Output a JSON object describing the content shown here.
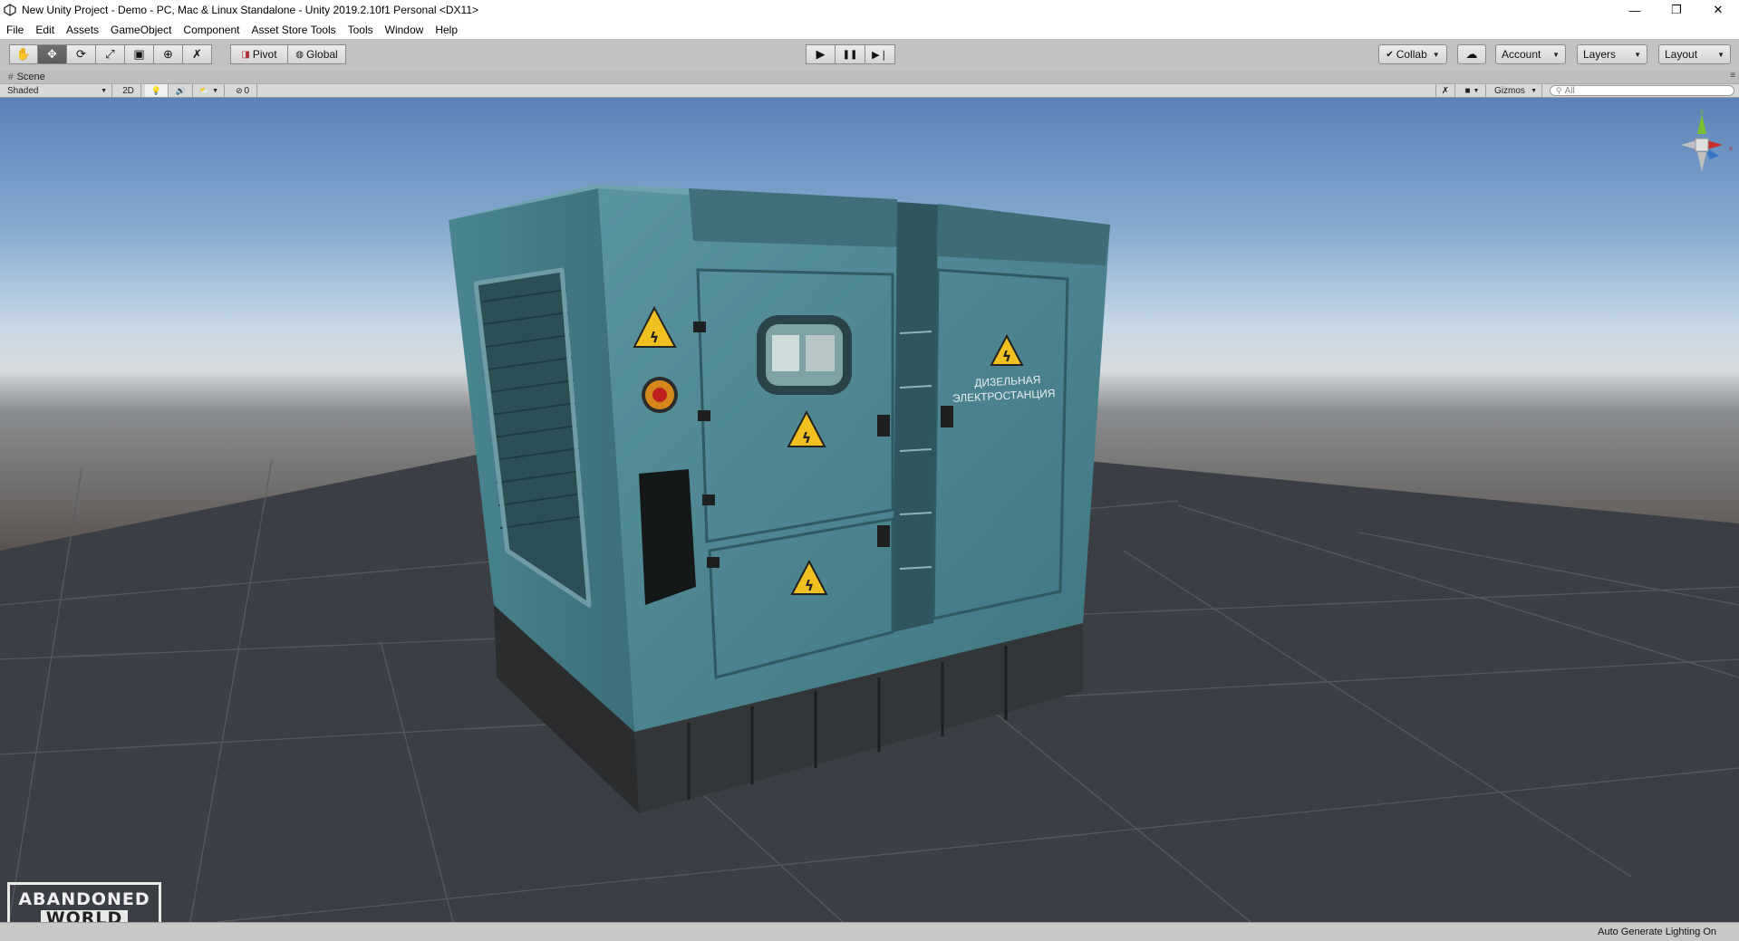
{
  "window": {
    "title": "New Unity Project - Demo - PC, Mac & Linux Standalone - Unity 2019.2.10f1 Personal <DX11>",
    "minimize_glyph": "—",
    "maximize_glyph": "❐",
    "close_glyph": "✕"
  },
  "menu": [
    "File",
    "Edit",
    "Assets",
    "GameObject",
    "Component",
    "Asset Store Tools",
    "Tools",
    "Window",
    "Help"
  ],
  "toolbar": {
    "tools": [
      {
        "name": "hand-tool-icon",
        "glyph": "✋"
      },
      {
        "name": "move-tool-icon",
        "glyph": "✥"
      },
      {
        "name": "rotate-tool-icon",
        "glyph": "⟳"
      },
      {
        "name": "scale-tool-icon",
        "glyph": "⤢"
      },
      {
        "name": "rect-tool-icon",
        "glyph": "▣"
      },
      {
        "name": "transform-tool-icon",
        "glyph": "⊕"
      },
      {
        "name": "custom-tool-icon",
        "glyph": "✗"
      }
    ],
    "active_tool_index": 1,
    "pivot_label": "Pivot",
    "global_label": "Global",
    "play_glyph": "▶",
    "pause_glyph": "❚❚",
    "step_glyph": "▶❘",
    "collab_label": "Collab",
    "cloud_glyph": "☁",
    "account_label": "Account",
    "layers_label": "Layers",
    "layout_label": "Layout"
  },
  "scene": {
    "tab_label": "Scene",
    "tab_icon": "#",
    "tab_menu_glyph": "≡",
    "shading_mode": "Shaded",
    "mode_2d_label": "2D",
    "light_glyph": "💡",
    "audio_glyph": "🔊",
    "effects_glyph": "⛅",
    "hidden_count": "0",
    "gizmos_label": "Gizmos",
    "search_placeholder": "All",
    "panel_text_1": "ДИЗЕЛЬНАЯ",
    "panel_text_2": "ЭЛЕКТРОСТАНЦИЯ",
    "logo_line_1": "ABANDONED",
    "logo_line_2": "WORLD"
  },
  "status": {
    "text": "Auto Generate Lighting On"
  },
  "colors": {
    "generator_body": "#4f8a94",
    "generator_dark": "#2b4a52",
    "sky_top": "#5f87b8",
    "ground": "#3a3d42",
    "warning": "#f0c020"
  }
}
